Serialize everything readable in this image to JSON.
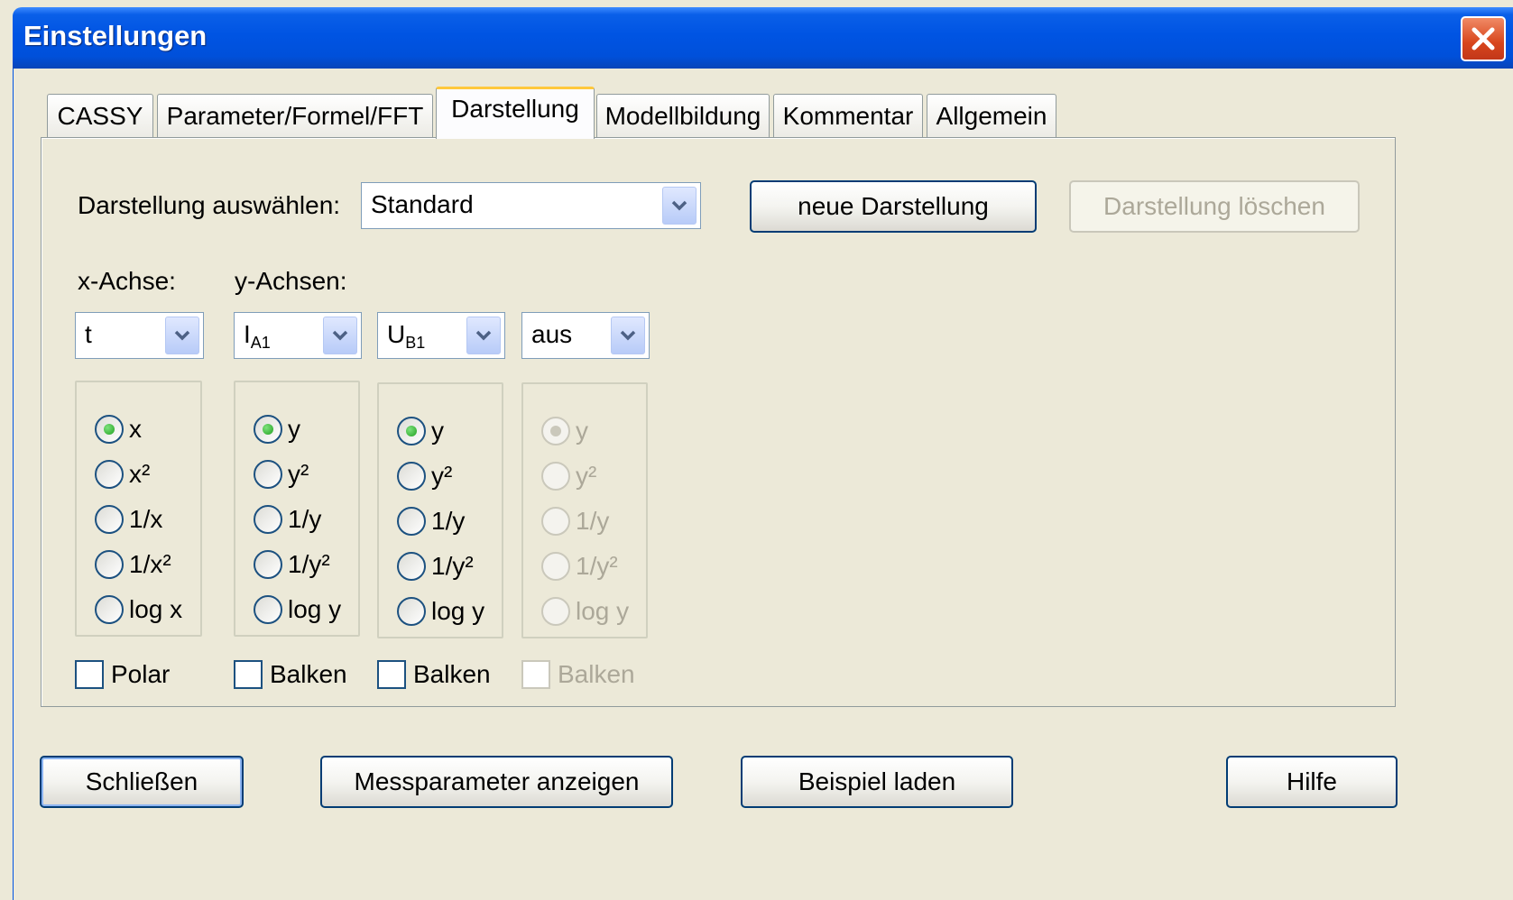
{
  "window": {
    "title": "Einstellungen",
    "close_glyph": "✕"
  },
  "tabs": [
    {
      "label": "CASSY",
      "active": false
    },
    {
      "label": "Parameter/Formel/FFT",
      "active": false
    },
    {
      "label": "Darstellung",
      "active": true
    },
    {
      "label": "Modellbildung",
      "active": false
    },
    {
      "label": "Kommentar",
      "active": false
    },
    {
      "label": "Allgemein",
      "active": false
    }
  ],
  "darstellung": {
    "select_label": "Darstellung auswählen:",
    "select_value": "Standard",
    "new_button": "neue Darstellung",
    "delete_button": "Darstellung löschen",
    "x_axis_label": "x-Achse:",
    "y_axes_label": "y-Achsen:",
    "x_combo": "t",
    "y1_combo_main": "I",
    "y1_combo_sub": "A1",
    "y2_combo_main": "U",
    "y2_combo_sub": "B1",
    "y3_combo": "aus",
    "x_options": [
      "x",
      "x²",
      "1/x",
      "1/x²",
      "log x"
    ],
    "y_options": [
      "y",
      "y²",
      "1/y",
      "1/y²",
      "log y"
    ],
    "polar_label": "Polar",
    "balken_label": "Balken"
  },
  "footer": {
    "close_button": "Schließen",
    "params_button": "Messparameter anzeigen",
    "example_button": "Beispiel laden",
    "help_button": "Hilfe"
  },
  "colors": {
    "titlebar": "#0054e3",
    "dialog_bg": "#ece9d8",
    "tab_highlight": "#ffc83c",
    "radio_dot": "#21a121"
  }
}
